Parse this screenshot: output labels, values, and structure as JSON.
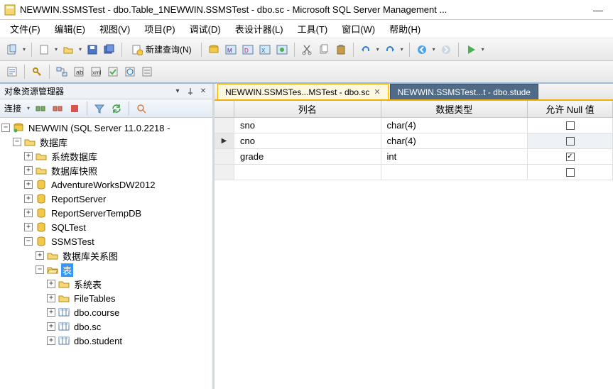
{
  "window": {
    "title": "NEWWIN.SSMSTest - dbo.Table_1NEWWIN.SSMSTest - dbo.sc - Microsoft SQL Server Management ..."
  },
  "menu": {
    "items": [
      "文件(F)",
      "编辑(E)",
      "视图(V)",
      "项目(P)",
      "调试(D)",
      "表设计器(L)",
      "工具(T)",
      "窗口(W)",
      "帮助(H)"
    ]
  },
  "toolbar": {
    "new_query_label": "新建查询(N)"
  },
  "object_explorer": {
    "title": "对象资源管理器",
    "connect_label": "连接",
    "root": "NEWWIN (SQL Server 11.0.2218 -",
    "nodes": {
      "databases": "数据库",
      "sys_db": "系统数据库",
      "db_snapshot": "数据库快照",
      "adv": "AdventureWorksDW2012",
      "rs": "ReportServer",
      "rstmp": "ReportServerTempDB",
      "sqltest": "SQLTest",
      "ssmstest": "SSMSTest",
      "diagram": "数据库关系图",
      "tables": "表",
      "sys_tables": "系统表",
      "filetables": "FileTables",
      "t_course": "dbo.course",
      "t_sc": "dbo.sc",
      "t_student": "dbo.student"
    }
  },
  "tabs": {
    "active": "NEWWIN.SSMSTes...MSTest - dbo.sc",
    "inactive": "NEWWIN.SSMSTest...t - dbo.stude"
  },
  "designer": {
    "headers": {
      "col_name": "列名",
      "data_type": "数据类型",
      "allow_null": "允许 Null 值"
    },
    "rows": [
      {
        "name": "sno",
        "type": "char(4)",
        "null": false,
        "active": false
      },
      {
        "name": "cno",
        "type": "char(4)",
        "null": false,
        "active": true
      },
      {
        "name": "grade",
        "type": "int",
        "null": true,
        "active": false
      }
    ]
  }
}
